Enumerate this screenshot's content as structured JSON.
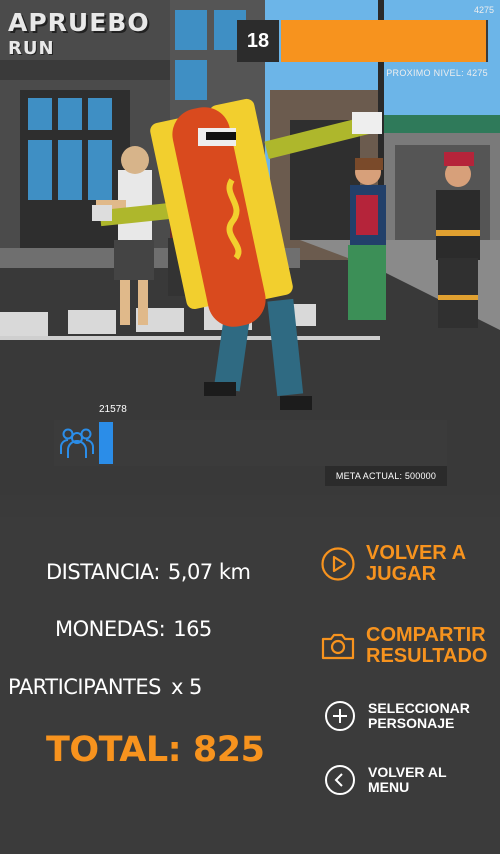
{
  "game": {
    "title_line1": "APRUEBO",
    "title_line2": "RUN"
  },
  "level": {
    "current": "18",
    "corner_value": "4275",
    "next_label": "PROXIMO NIVEL: 4275",
    "progress_fraction": 0.99
  },
  "crowd": {
    "count": "21578",
    "goal_label": "META ACTUAL: 500000",
    "progress_fraction": 0.04
  },
  "stats": {
    "distance_label": "DISTANCIA:",
    "distance_value": "5,07 km",
    "coins_label": "MONEDAS:",
    "coins_value": "165",
    "participants_label": "PARTICIPANTES",
    "participants_value": "x 5",
    "total_label": "TOTAL:",
    "total_value": "825"
  },
  "actions": {
    "play_again": {
      "line1": "VOLVER A",
      "line2": "JUGAR",
      "icon": "play-circle-icon"
    },
    "share": {
      "line1": "COMPARTIR",
      "line2": "RESULTADO",
      "icon": "camera-icon"
    },
    "select_character": {
      "line1": "SELECCIONAR",
      "line2": "PERSONAJE",
      "icon": "plus-circle-icon"
    },
    "back_menu": {
      "line1": "VOLVER AL",
      "line2": "MENU",
      "icon": "back-circle-icon"
    }
  },
  "colors": {
    "accent": "#f7931e",
    "crowd_bar": "#2b8de8",
    "overlay": "#3c3c3c"
  }
}
